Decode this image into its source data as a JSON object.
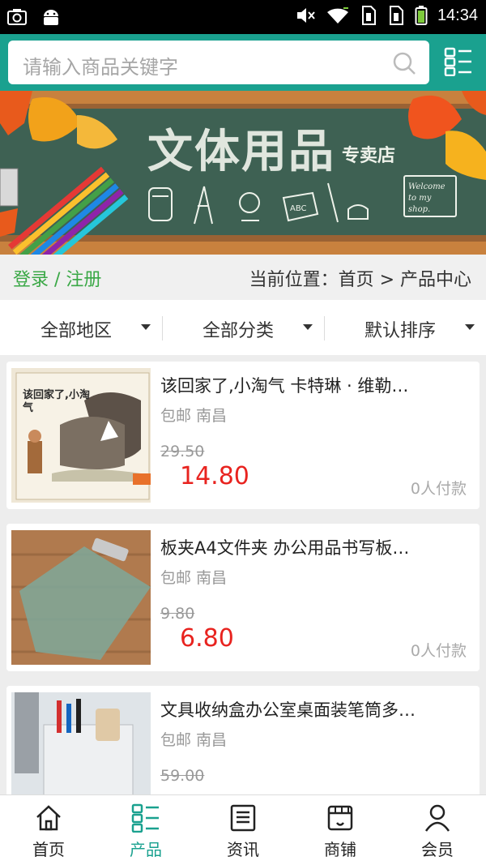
{
  "status_bar": {
    "time": "14:34"
  },
  "search": {
    "placeholder": "请输入商品关键字"
  },
  "banner": {
    "title": "文体用品",
    "subtitle": "专卖店",
    "board_line1": "Welcome",
    "board_line2": "to my shop.",
    "book_label": "ABC"
  },
  "breadcrumb": {
    "login": "登录 / 注册",
    "location": "当前位置：首页 > 产品中心"
  },
  "filters": [
    {
      "label": "全部地区"
    },
    {
      "label": "全部分类"
    },
    {
      "label": "默认排序"
    }
  ],
  "products": [
    {
      "title": "该回家了,小淘气 卡特琳 · 维勒…",
      "meta": "包邮 南昌",
      "old_price": "29.50",
      "price": "14.80",
      "sold": "0人付款",
      "thumb_text": "该回家了,小淘气"
    },
    {
      "title": "板夹A4文件夹 办公用品书写板…",
      "meta": "包邮 南昌",
      "old_price": "9.80",
      "price": "6.80",
      "sold": "0人付款"
    },
    {
      "title": "文具收纳盒办公室桌面装笔筒多…",
      "meta": "包邮 南昌",
      "old_price": "59.00",
      "price": "",
      "sold": ""
    }
  ],
  "nav": [
    {
      "label": "首页",
      "icon": "home-icon"
    },
    {
      "label": "产品",
      "icon": "product-list-icon"
    },
    {
      "label": "资讯",
      "icon": "news-icon"
    },
    {
      "label": "商铺",
      "icon": "shop-icon"
    },
    {
      "label": "会员",
      "icon": "member-icon"
    }
  ],
  "colors": {
    "primary": "#1aa18f",
    "price": "#e8231f",
    "login": "#3aa846"
  }
}
